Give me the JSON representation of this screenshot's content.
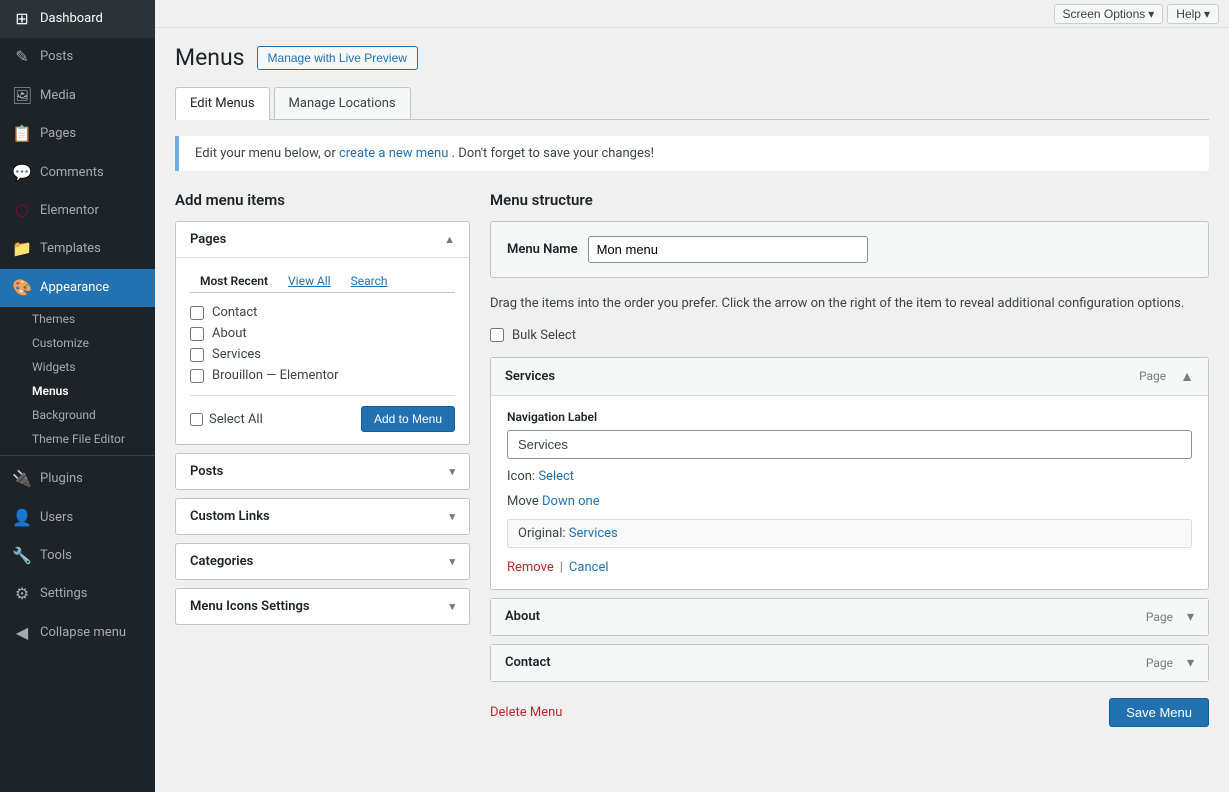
{
  "topbar": {
    "screen_options_label": "Screen Options",
    "help_label": "Help"
  },
  "sidebar": {
    "items": [
      {
        "id": "dashboard",
        "label": "Dashboard",
        "icon": "⊞"
      },
      {
        "id": "posts",
        "label": "Posts",
        "icon": "📄"
      },
      {
        "id": "media",
        "label": "Media",
        "icon": "🖼"
      },
      {
        "id": "pages",
        "label": "Pages",
        "icon": "📋"
      },
      {
        "id": "comments",
        "label": "Comments",
        "icon": "💬"
      },
      {
        "id": "elementor",
        "label": "Elementor",
        "icon": "⬡"
      },
      {
        "id": "templates",
        "label": "Templates",
        "icon": "📁"
      },
      {
        "id": "appearance",
        "label": "Appearance",
        "icon": "🎨",
        "active": true
      }
    ],
    "sub_items": [
      {
        "id": "themes",
        "label": "Themes"
      },
      {
        "id": "customize",
        "label": "Customize"
      },
      {
        "id": "widgets",
        "label": "Widgets"
      },
      {
        "id": "menus",
        "label": "Menus",
        "active": true
      },
      {
        "id": "background",
        "label": "Background"
      },
      {
        "id": "theme-file-editor",
        "label": "Theme File Editor"
      }
    ],
    "bottom_items": [
      {
        "id": "plugins",
        "label": "Plugins",
        "icon": "🔌"
      },
      {
        "id": "users",
        "label": "Users",
        "icon": "👤"
      },
      {
        "id": "tools",
        "label": "Tools",
        "icon": "🔧"
      },
      {
        "id": "settings",
        "label": "Settings",
        "icon": "⚙"
      },
      {
        "id": "collapse",
        "label": "Collapse menu",
        "icon": "◀"
      }
    ]
  },
  "page": {
    "title": "Menus",
    "live_preview_btn": "Manage with Live Preview",
    "tabs": [
      {
        "id": "edit-menus",
        "label": "Edit Menus",
        "active": true
      },
      {
        "id": "manage-locations",
        "label": "Manage Locations"
      }
    ],
    "notice": {
      "text_before": "Edit your menu below, or",
      "link_text": "create a new menu",
      "text_after": ". Don't forget to save your changes!"
    }
  },
  "add_menu_items": {
    "title": "Add menu items",
    "pages_panel": {
      "label": "Pages",
      "mini_tabs": [
        {
          "id": "most-recent",
          "label": "Most Recent",
          "active": true
        },
        {
          "id": "view-all",
          "label": "View All"
        },
        {
          "id": "search",
          "label": "Search"
        }
      ],
      "items": [
        {
          "id": "contact",
          "label": "Contact"
        },
        {
          "id": "about",
          "label": "About"
        },
        {
          "id": "services",
          "label": "Services"
        },
        {
          "id": "brouillon",
          "label": "Brouillon — Elementor"
        }
      ],
      "select_all_label": "Select All",
      "add_to_menu_btn": "Add to Menu"
    },
    "posts_panel": {
      "label": "Posts"
    },
    "custom_links_panel": {
      "label": "Custom Links"
    },
    "categories_panel": {
      "label": "Categories"
    },
    "menu_icons_panel": {
      "label": "Menu Icons Settings"
    }
  },
  "menu_structure": {
    "title": "Menu structure",
    "menu_name_label": "Menu Name",
    "menu_name_value": "Mon menu",
    "drag_hint": "Drag the items into the order you prefer. Click the arrow on the right of the item to reveal additional configuration options.",
    "bulk_select_label": "Bulk Select",
    "items": [
      {
        "id": "services",
        "title": "Services",
        "type": "Page",
        "expanded": true,
        "nav_label_field": "Navigation Label",
        "nav_label_value": "Services",
        "icon_label": "Icon:",
        "icon_link": "Select",
        "move_label": "Move",
        "move_link": "Down one",
        "original_label": "Original:",
        "original_link": "Services",
        "remove_label": "Remove",
        "cancel_label": "Cancel"
      },
      {
        "id": "about",
        "title": "About",
        "type": "Page",
        "expanded": false
      },
      {
        "id": "contact",
        "title": "Contact",
        "type": "Page",
        "expanded": false
      }
    ],
    "delete_menu_label": "Delete Menu",
    "save_btn": "Save Menu"
  }
}
